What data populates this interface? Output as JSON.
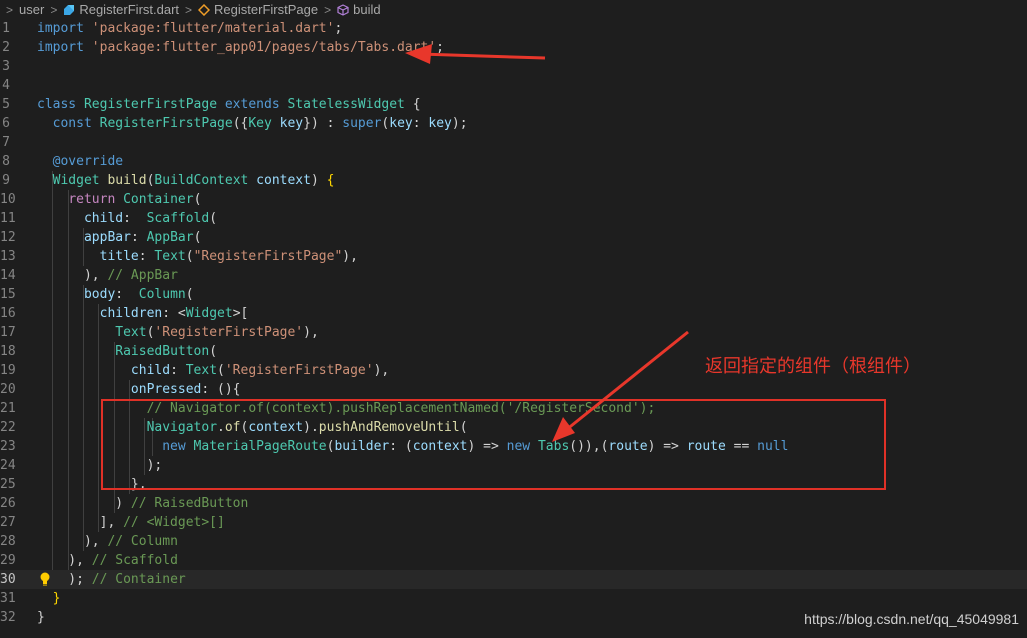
{
  "breadcrumb": {
    "items": [
      "user",
      "RegisterFirst.dart",
      "RegisterFirstPage",
      "build"
    ],
    "separator": ">"
  },
  "editor": {
    "active_line": 30,
    "lines": [
      {
        "n": "1",
        "t": [
          [
            "kw",
            "import"
          ],
          [
            "pl",
            " "
          ],
          [
            "str",
            "'package:flutter/material.dart'"
          ],
          [
            "pl",
            ";"
          ]
        ]
      },
      {
        "n": "2",
        "t": [
          [
            "kw",
            "import"
          ],
          [
            "pl",
            " "
          ],
          [
            "str",
            "'package:flutter_app01/pages/tabs/Tabs.dart'"
          ],
          [
            "pl",
            ";"
          ]
        ]
      },
      {
        "n": "3",
        "t": []
      },
      {
        "n": "4",
        "t": []
      },
      {
        "n": "5",
        "t": [
          [
            "kw",
            "class"
          ],
          [
            "pl",
            " "
          ],
          [
            "ty",
            "RegisterFirstPage"
          ],
          [
            "pl",
            " "
          ],
          [
            "kw",
            "extends"
          ],
          [
            "pl",
            " "
          ],
          [
            "ty",
            "StatelessWidget"
          ],
          [
            "pl",
            " {"
          ]
        ]
      },
      {
        "n": "6",
        "t": [
          [
            "pl",
            "  "
          ],
          [
            "kw",
            "const"
          ],
          [
            "pl",
            " "
          ],
          [
            "ty",
            "RegisterFirstPage"
          ],
          [
            "pl",
            "({"
          ],
          [
            "ty",
            "Key"
          ],
          [
            "pl",
            " "
          ],
          [
            "var",
            "key"
          ],
          [
            "pl",
            "}) : "
          ],
          [
            "kw",
            "super"
          ],
          [
            "pl",
            "("
          ],
          [
            "var",
            "key"
          ],
          [
            "pl",
            ": "
          ],
          [
            "var",
            "key"
          ],
          [
            "pl",
            ");"
          ]
        ]
      },
      {
        "n": "7",
        "t": []
      },
      {
        "n": "8",
        "t": [
          [
            "pl",
            "  "
          ],
          [
            "kw",
            "@override"
          ]
        ]
      },
      {
        "n": "9",
        "t": [
          [
            "pl",
            "  "
          ],
          [
            "ty",
            "Widget"
          ],
          [
            "pl",
            " "
          ],
          [
            "fn",
            "build"
          ],
          [
            "pl",
            "("
          ],
          [
            "ty",
            "BuildContext"
          ],
          [
            "pl",
            " "
          ],
          [
            "var",
            "context"
          ],
          [
            "pl",
            ") "
          ],
          [
            "br-y",
            "{"
          ]
        ]
      },
      {
        "n": "10",
        "t": [
          [
            "pl",
            "    "
          ],
          [
            "ctrl",
            "return"
          ],
          [
            "pl",
            " "
          ],
          [
            "ty",
            "Container"
          ],
          [
            "pl",
            "("
          ]
        ]
      },
      {
        "n": "11",
        "t": [
          [
            "pl",
            "      "
          ],
          [
            "var",
            "child"
          ],
          [
            "pl",
            ":  "
          ],
          [
            "ty",
            "Scaffold"
          ],
          [
            "pl",
            "("
          ]
        ]
      },
      {
        "n": "12",
        "t": [
          [
            "pl",
            "      "
          ],
          [
            "var",
            "appBar"
          ],
          [
            "pl",
            ": "
          ],
          [
            "ty",
            "AppBar"
          ],
          [
            "pl",
            "("
          ]
        ]
      },
      {
        "n": "13",
        "t": [
          [
            "pl",
            "        "
          ],
          [
            "var",
            "title"
          ],
          [
            "pl",
            ": "
          ],
          [
            "ty",
            "Text"
          ],
          [
            "pl",
            "("
          ],
          [
            "str",
            "\"RegisterFirstPage\""
          ],
          [
            "pl",
            "),"
          ]
        ]
      },
      {
        "n": "14",
        "t": [
          [
            "pl",
            "      ), "
          ],
          [
            "cm",
            "// AppBar"
          ]
        ]
      },
      {
        "n": "15",
        "t": [
          [
            "pl",
            "      "
          ],
          [
            "var",
            "body"
          ],
          [
            "pl",
            ":  "
          ],
          [
            "ty",
            "Column"
          ],
          [
            "pl",
            "("
          ]
        ]
      },
      {
        "n": "16",
        "t": [
          [
            "pl",
            "        "
          ],
          [
            "var",
            "children"
          ],
          [
            "pl",
            ": <"
          ],
          [
            "ty",
            "Widget"
          ],
          [
            "pl",
            ">["
          ]
        ]
      },
      {
        "n": "17",
        "t": [
          [
            "pl",
            "          "
          ],
          [
            "ty",
            "Text"
          ],
          [
            "pl",
            "("
          ],
          [
            "str",
            "'RegisterFirstPage'"
          ],
          [
            "pl",
            "),"
          ]
        ]
      },
      {
        "n": "18",
        "t": [
          [
            "pl",
            "          "
          ],
          [
            "ty",
            "RaisedButton"
          ],
          [
            "pl",
            "("
          ]
        ]
      },
      {
        "n": "19",
        "t": [
          [
            "pl",
            "            "
          ],
          [
            "var",
            "child"
          ],
          [
            "pl",
            ": "
          ],
          [
            "ty",
            "Text"
          ],
          [
            "pl",
            "("
          ],
          [
            "str",
            "'RegisterFirstPage'"
          ],
          [
            "pl",
            "),"
          ]
        ]
      },
      {
        "n": "20",
        "t": [
          [
            "pl",
            "            "
          ],
          [
            "var",
            "onPressed"
          ],
          [
            "pl",
            ": (){"
          ]
        ]
      },
      {
        "n": "21",
        "t": [
          [
            "pl",
            "              "
          ],
          [
            "cm",
            "// Navigator.of(context).pushReplacementNamed('/RegisterSecond');"
          ]
        ]
      },
      {
        "n": "22",
        "t": [
          [
            "pl",
            "              "
          ],
          [
            "ty",
            "Navigator"
          ],
          [
            "pl",
            "."
          ],
          [
            "fn",
            "of"
          ],
          [
            "pl",
            "("
          ],
          [
            "var",
            "context"
          ],
          [
            "pl",
            ")."
          ],
          [
            "fn",
            "pushAndRemoveUntil"
          ],
          [
            "pl",
            "("
          ]
        ]
      },
      {
        "n": "23",
        "t": [
          [
            "pl",
            "                "
          ],
          [
            "kw",
            "new"
          ],
          [
            "pl",
            " "
          ],
          [
            "ty",
            "MaterialPageRoute"
          ],
          [
            "pl",
            "("
          ],
          [
            "var",
            "builder"
          ],
          [
            "pl",
            ": ("
          ],
          [
            "var",
            "context"
          ],
          [
            "pl",
            ") => "
          ],
          [
            "kw",
            "new"
          ],
          [
            "pl",
            " "
          ],
          [
            "ty",
            "Tabs"
          ],
          [
            "pl",
            "()),("
          ],
          [
            "var",
            "route"
          ],
          [
            "pl",
            ") => "
          ],
          [
            "var",
            "route"
          ],
          [
            "pl",
            " == "
          ],
          [
            "kw",
            "null"
          ]
        ]
      },
      {
        "n": "24",
        "t": [
          [
            "pl",
            "              );"
          ]
        ]
      },
      {
        "n": "25",
        "t": [
          [
            "pl",
            "            },"
          ]
        ]
      },
      {
        "n": "26",
        "t": [
          [
            "pl",
            "          ) "
          ],
          [
            "cm",
            "// RaisedButton"
          ]
        ]
      },
      {
        "n": "27",
        "t": [
          [
            "pl",
            "        ], "
          ],
          [
            "cm",
            "// <Widget>[]"
          ]
        ]
      },
      {
        "n": "28",
        "t": [
          [
            "pl",
            "      ), "
          ],
          [
            "cm",
            "// Column"
          ]
        ]
      },
      {
        "n": "29",
        "t": [
          [
            "pl",
            "    ), "
          ],
          [
            "cm",
            "// Scaffold"
          ]
        ]
      },
      {
        "n": "30",
        "t": [
          [
            "pl",
            "    ); "
          ],
          [
            "cm",
            "// Container"
          ]
        ]
      },
      {
        "n": "31",
        "t": [
          [
            "pl",
            "  "
          ],
          [
            "br-y",
            "}"
          ]
        ]
      },
      {
        "n": "32",
        "t": [
          [
            "pl",
            "}"
          ]
        ]
      }
    ]
  },
  "annotation": {
    "text": "返回指定的组件（根组件）",
    "color": "#e03127"
  },
  "watermark": "https://blog.csdn.net/qq_45049981",
  "icons": {
    "file": "dart-file-icon",
    "class": "class-icon",
    "method": "method-cube-icon",
    "lightbulb": "lightbulb-icon"
  }
}
